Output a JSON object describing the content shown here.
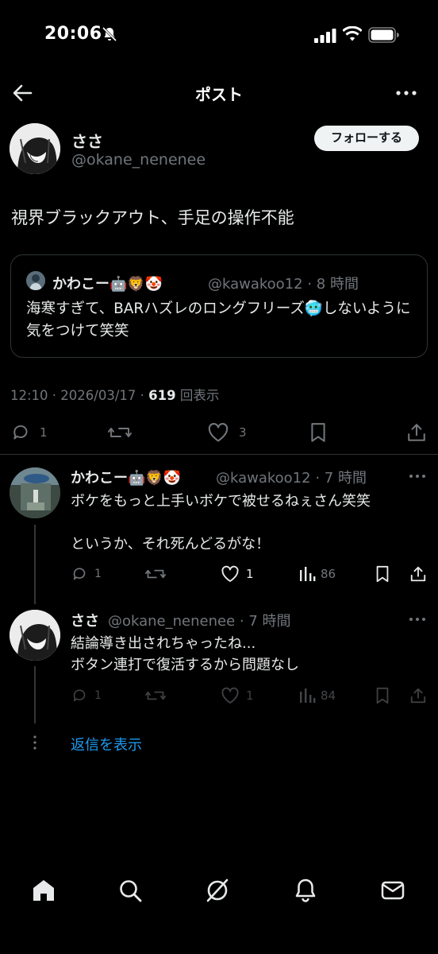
{
  "status_bar": {
    "time": "20:06"
  },
  "nav": {
    "title": "ポスト"
  },
  "post": {
    "author_name": "ささ",
    "author_handle": "@okane_nenenee",
    "follow_label": "フォローする",
    "text": "視界ブラックアウト、手足の操作不能",
    "quote": {
      "author_name": "かわこー🤖🦁🤡",
      "author_handle": "@kawakoo12 · 8 時間",
      "text": "海寒すぎて、BARハズレのロングフリーズ🥶しないように気をつけて笑笑"
    },
    "meta_prefix": "12:10 · 2026/03/17 · ",
    "views_count": "619",
    "views_suffix": " 回表示",
    "reply_count": "1",
    "repost_count": "",
    "like_count": "3"
  },
  "replies": [
    {
      "author_name": "かわこー🤖🦁🤡",
      "author_handle": "@kawakoo12 · 7 時間",
      "text": "ボケをもっと上手いボケで被せるねぇさん笑笑\n\nというか、それ死んどるがな！",
      "reply_count": "1",
      "repost_count": "",
      "like_count": "1",
      "view_count": "86"
    },
    {
      "author_name": "ささ",
      "author_handle": "@okane_nenenee · 7 時間",
      "text": "結論導き出されちゃったね...\nボタン連打で復活するから問題なし",
      "reply_count": "1",
      "repost_count": "",
      "like_count": "1",
      "view_count": "84"
    }
  ],
  "show_replies_label": "返信を表示",
  "colors": {
    "accent": "#1d9bf0",
    "text": "#e7e9ea",
    "secondary": "#71767b",
    "divider": "#2f3336",
    "background": "#000000"
  },
  "tabs": [
    "home-icon",
    "search-icon",
    "grok-icon",
    "notifications-icon",
    "messages-icon"
  ]
}
